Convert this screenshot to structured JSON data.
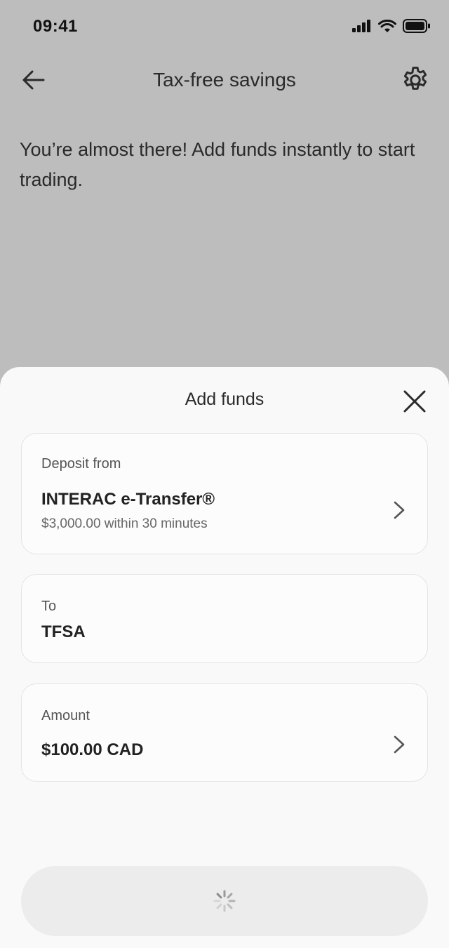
{
  "status_bar": {
    "time": "09:41"
  },
  "nav": {
    "title": "Tax-free savings"
  },
  "headline": "You’re almost there! Add funds instantly to start trading.",
  "sheet": {
    "title": "Add funds",
    "deposit_from": {
      "label": "Deposit from",
      "value": "INTERAC e-Transfer®",
      "sub": "$3,000.00 within 30 minutes"
    },
    "to": {
      "label": "To",
      "value": "TFSA"
    },
    "amount": {
      "label": "Amount",
      "value": "$100.00 CAD"
    },
    "submit": {
      "state": "loading"
    }
  },
  "colors": {
    "backdrop": "#bdbdbd",
    "sheet": "#f9f9f9",
    "text": "#222222",
    "button_disabled": "#ececec"
  }
}
